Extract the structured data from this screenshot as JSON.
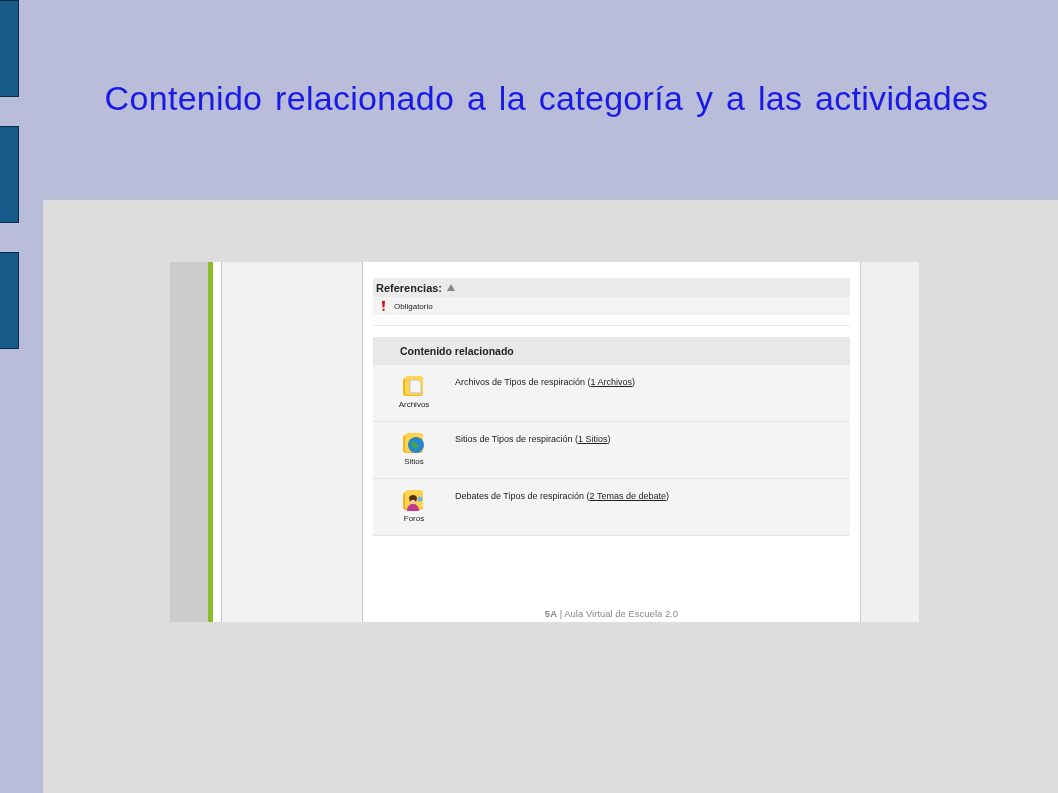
{
  "slide": {
    "title": "Contenido relacionado a la categoría y a las actividades"
  },
  "references": {
    "title": "Referencias:",
    "expanded": true,
    "items": [
      {
        "label": "Obligatorio"
      }
    ]
  },
  "related": {
    "title": "Contenido relacionado",
    "rows": [
      {
        "kind": "files",
        "icon_label": "Archivos",
        "text": "Archivos de Tipos de respiración (",
        "link": "1 Archivos",
        "suffix": ")"
      },
      {
        "kind": "sites",
        "icon_label": "Sitios",
        "text": "Sitios de Tipos de respiración (",
        "link": "1 Sitios",
        "suffix": ")"
      },
      {
        "kind": "forums",
        "icon_label": "Foros",
        "text": "Debates de Tipos de respiración (",
        "link": "2 Temas de debate",
        "suffix": ")"
      }
    ]
  },
  "footer": {
    "text": "**5A** | Aula Virtual de Escuela 2.0"
  }
}
